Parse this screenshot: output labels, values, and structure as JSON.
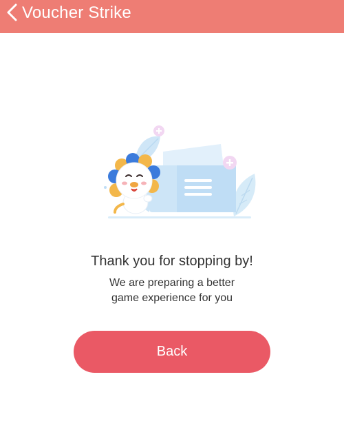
{
  "header": {
    "back_icon": "chevron-left-icon",
    "title": "Voucher Strike"
  },
  "illustration": {
    "description_icon": "mascot-voucher-illustration"
  },
  "message": {
    "title": "Thank you for stopping by!",
    "subtitle": "We are preparing a better\ngame experience for you"
  },
  "actions": {
    "back_label": "Back"
  },
  "colors": {
    "header": "#ee7d74",
    "button": "#ea5965",
    "text": "#333333"
  }
}
